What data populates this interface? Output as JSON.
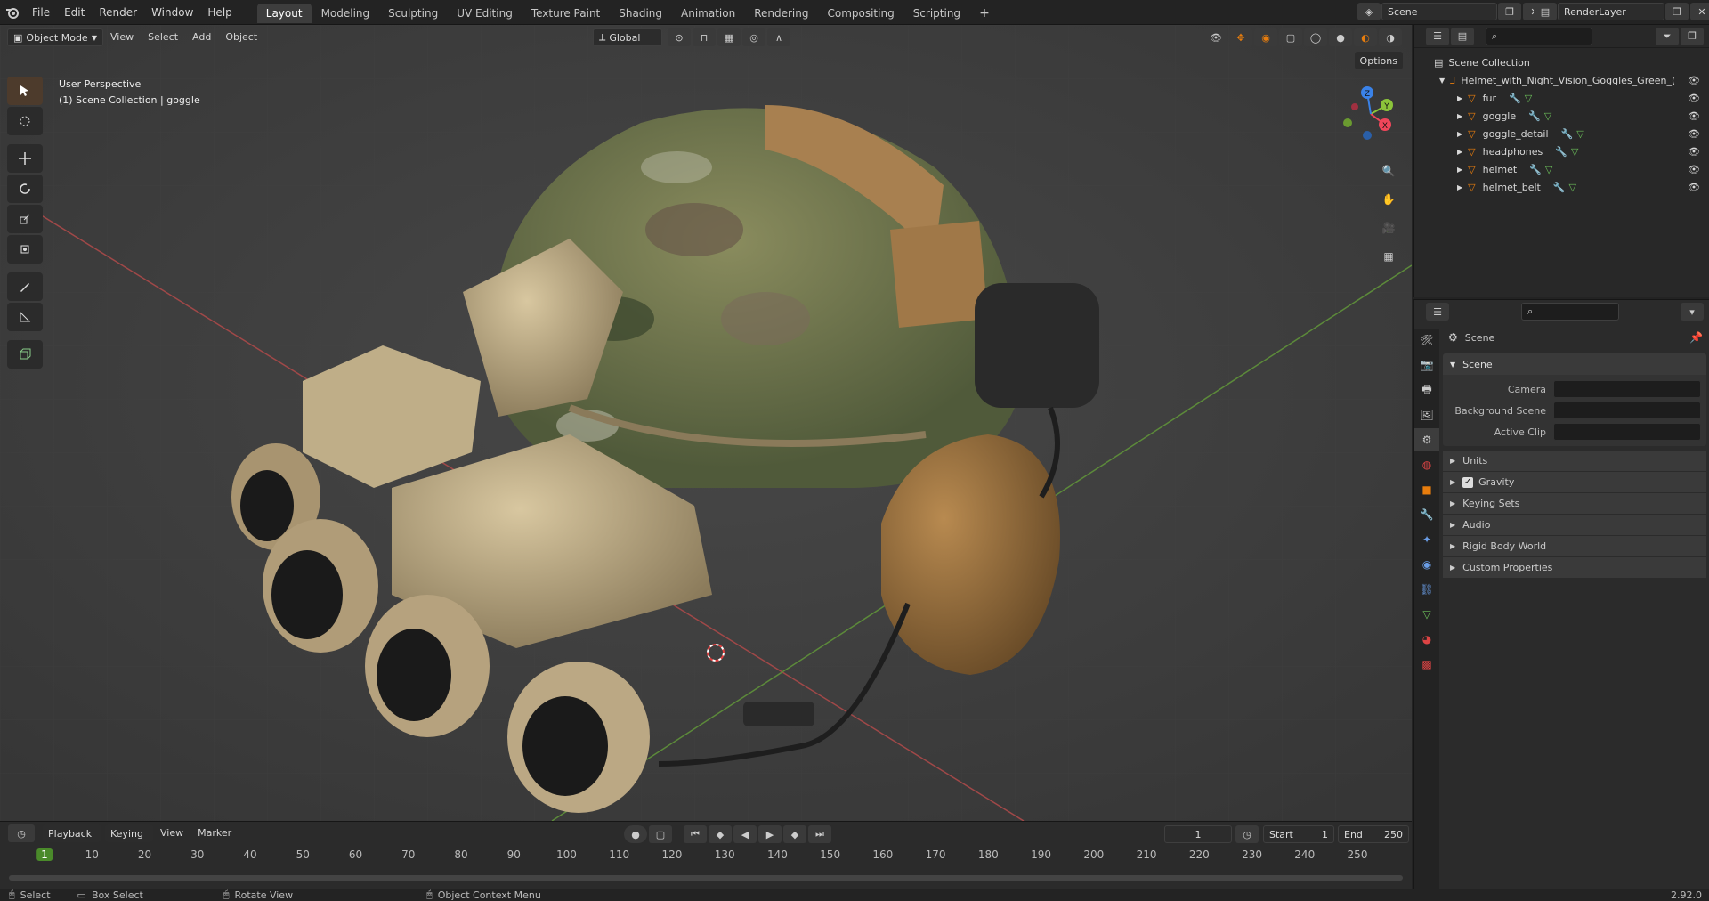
{
  "topbar": {
    "menus": [
      "File",
      "Edit",
      "Render",
      "Window",
      "Help"
    ],
    "workspace_tabs": [
      "Layout",
      "Modeling",
      "Sculpting",
      "UV Editing",
      "Texture Paint",
      "Shading",
      "Animation",
      "Rendering",
      "Compositing",
      "Scripting"
    ],
    "active_tab": "Layout",
    "scene_label": "Scene",
    "render_layer_label": "RenderLayer"
  },
  "viewport": {
    "mode_label": "Object Mode",
    "menus": [
      "View",
      "Select",
      "Add",
      "Object"
    ],
    "transform_label": "Global",
    "options_label": "Options",
    "overlay_title": "User Perspective",
    "overlay_sub": "(1) Scene Collection | goggle",
    "gizmo": {
      "x": "X",
      "y": "Y",
      "z": "Z"
    }
  },
  "timeline": {
    "menus": [
      "Playback",
      "Keying",
      "View",
      "Marker"
    ],
    "current_frame": "1",
    "start_label": "Start",
    "start_value": "1",
    "end_label": "End",
    "end_value": "250",
    "ticks": [
      "1",
      "10",
      "20",
      "30",
      "40",
      "50",
      "60",
      "70",
      "80",
      "90",
      "100",
      "110",
      "120",
      "130",
      "140",
      "150",
      "160",
      "170",
      "180",
      "190",
      "200",
      "210",
      "220",
      "230",
      "240",
      "250"
    ]
  },
  "statusbar": {
    "select": "Select",
    "box_select": "Box Select",
    "rotate_view": "Rotate View",
    "context_menu": "Object Context Menu",
    "version": "2.92.0"
  },
  "outliner": {
    "root": "Scene Collection",
    "collection": "Helmet_with_Night_Vision_Goggles_Green_(",
    "items": [
      "fur",
      "goggle",
      "goggle_detail",
      "headphones",
      "helmet",
      "helmet_belt"
    ]
  },
  "properties": {
    "header": "Scene",
    "panel_title": "Scene",
    "rows": [
      {
        "label": "Camera"
      },
      {
        "label": "Background Scene"
      },
      {
        "label": "Active Clip"
      }
    ],
    "subpanels": [
      "Units",
      "Gravity",
      "Keying Sets",
      "Audio",
      "Rigid Body World",
      "Custom Properties"
    ]
  },
  "colors": {
    "accent": "#e87d0d",
    "axis_red": "#d44a4a",
    "axis_green": "#6ca33b",
    "gizmo_x": "#f0465a",
    "gizmo_y": "#8bc43a",
    "gizmo_z": "#3a82e8"
  }
}
